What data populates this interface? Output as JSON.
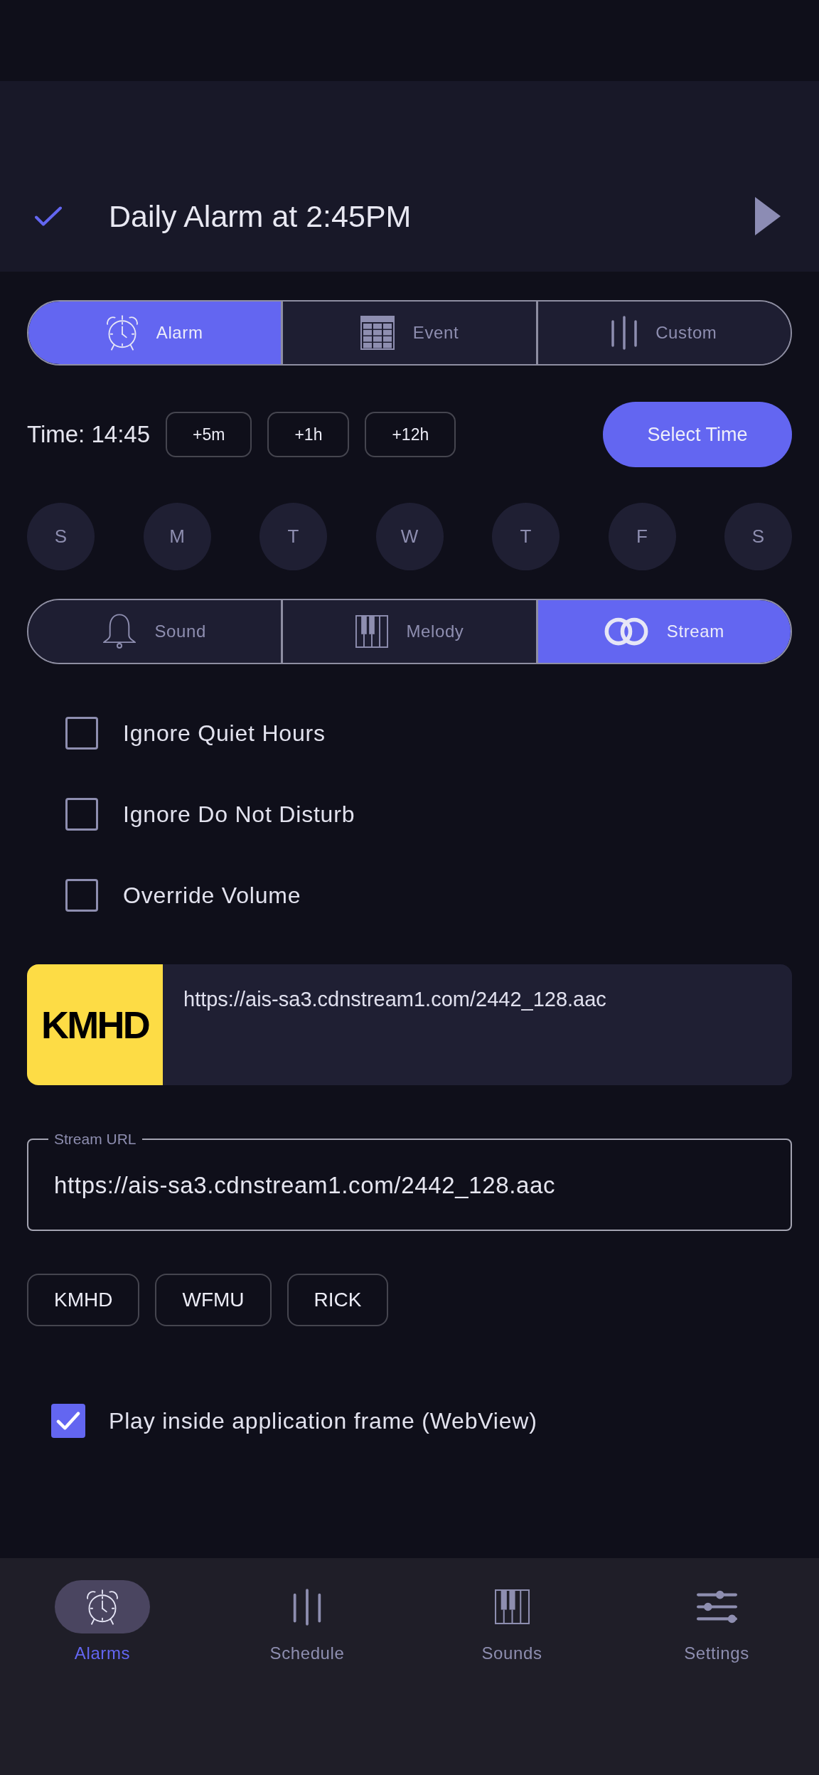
{
  "header": {
    "title": "Daily Alarm at 2:45PM"
  },
  "trigger_tabs": [
    {
      "label": "Alarm",
      "kind": "alarm",
      "selected": true
    },
    {
      "label": "Event",
      "kind": "grid",
      "selected": false
    },
    {
      "label": "Custom",
      "kind": "bars",
      "selected": false
    }
  ],
  "time": {
    "label": "Time: 14:45",
    "adjust_buttons": [
      "+5m",
      "+1h",
      "+12h"
    ],
    "select_button": "Select Time"
  },
  "days": [
    {
      "label": "S",
      "selected": false
    },
    {
      "label": "M",
      "selected": false
    },
    {
      "label": "T",
      "selected": false
    },
    {
      "label": "W",
      "selected": false
    },
    {
      "label": "T",
      "selected": false
    },
    {
      "label": "F",
      "selected": false
    },
    {
      "label": "S",
      "selected": false
    }
  ],
  "sound_tabs": [
    {
      "label": "Sound",
      "kind": "bell",
      "selected": false
    },
    {
      "label": "Melody",
      "kind": "piano",
      "selected": false
    },
    {
      "label": "Stream",
      "kind": "rings",
      "selected": true
    }
  ],
  "options": [
    {
      "label": "Ignore Quiet Hours",
      "checked": false
    },
    {
      "label": "Ignore Do Not Disturb",
      "checked": false
    },
    {
      "label": "Override Volume",
      "checked": false
    }
  ],
  "stream_card": {
    "logo_text": "KMHD",
    "url": "https://ais-sa3.cdnstream1.com/2442_128.aac"
  },
  "stream_url_field": {
    "label": "Stream URL",
    "value": "https://ais-sa3.cdnstream1.com/2442_128.aac"
  },
  "presets": [
    "KMHD",
    "WFMU",
    "RICK"
  ],
  "webview_option": {
    "label": "Play inside application frame (WebView)",
    "checked": true
  },
  "bottom_nav": [
    {
      "label": "Alarms",
      "kind": "alarm",
      "selected": true
    },
    {
      "label": "Schedule",
      "kind": "bars",
      "selected": false
    },
    {
      "label": "Sounds",
      "kind": "piano",
      "selected": false
    },
    {
      "label": "Settings",
      "kind": "sliders",
      "selected": false
    }
  ]
}
